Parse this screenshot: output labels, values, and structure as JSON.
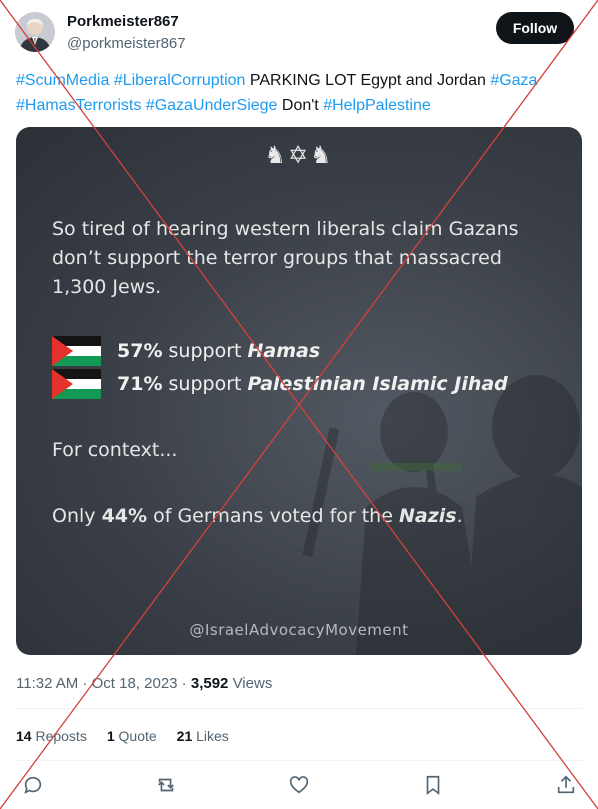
{
  "author": {
    "display_name": "Porkmeister867",
    "handle": "@porkmeister867",
    "avatar_icon": "profile-photo"
  },
  "follow_label": "Follow",
  "tweet": {
    "tags_1": "#ScumMedia #LiberalCorruption",
    "text_1": " PARKING LOT Egypt and Jordan ",
    "tag_gaza": "#Gaza",
    "tags_2": "#HamasTerrorists #GazaUnderSiege",
    "text_2": " Don't ",
    "tag_help": "#HelpPalestine"
  },
  "card": {
    "emblem": "♞✡♞",
    "headline": "So tired of hearing western liberals claim Gazans don’t support the terror groups that massacred 1,300 Jews.",
    "stat1_pct": "57%",
    "stat1_mid": " support ",
    "stat1_group": "Hamas",
    "stat2_pct": "71%",
    "stat2_mid": " support ",
    "stat2_group": "Palestinian Islamic Jihad",
    "context": "For context...",
    "only_pre": "Only ",
    "only_pct": "44%",
    "only_mid": " of Germans voted for the ",
    "only_group": "Nazis",
    "only_end": ".",
    "watermark": "@IsraelAdvocacyMovement"
  },
  "meta": {
    "time": "11:32 AM",
    "sep1": " · ",
    "date": "Oct 18, 2023",
    "sep2": " · ",
    "views_count": "3,592",
    "views_label": " Views"
  },
  "stats": {
    "reposts_count": "14",
    "reposts_label": " Reposts",
    "quotes_count": "1",
    "quotes_label": " Quote",
    "likes_count": "21",
    "likes_label": " Likes"
  },
  "colors": {
    "link": "#1d9bf0",
    "cross_out": "#d6403a",
    "flag_red": "#e4312b",
    "flag_green": "#149954"
  },
  "icons": [
    "reply-icon",
    "repost-icon",
    "like-icon",
    "bookmark-icon",
    "share-icon"
  ]
}
